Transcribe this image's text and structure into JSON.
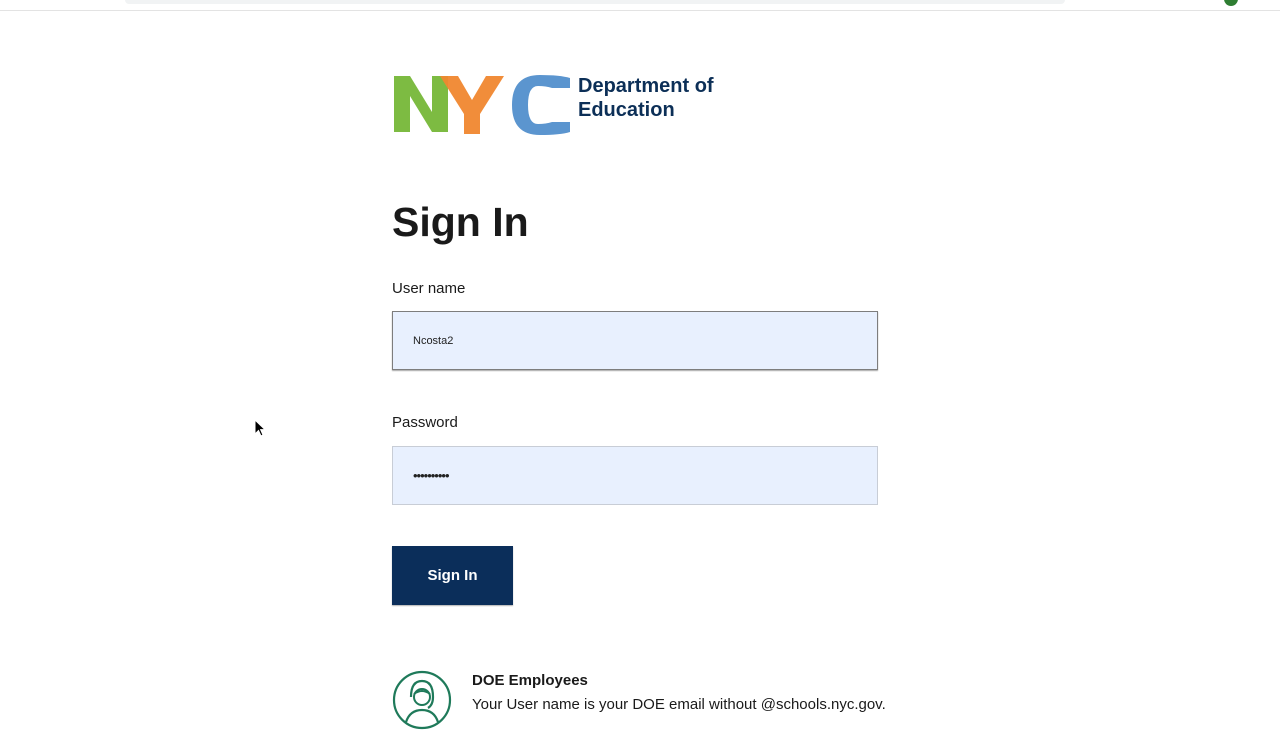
{
  "brand": {
    "logo_letters": "NYC",
    "department_line1": "Department of",
    "department_line2": "Education",
    "colors": {
      "n_green": "#7dbb42",
      "y_orange": "#f0872f",
      "c_blue": "#5b95cf",
      "navy_text": "#0c2f57"
    }
  },
  "form": {
    "title": "Sign In",
    "username_label": "User name",
    "username_value": "Ncosta2",
    "password_label": "Password",
    "password_value": "••••••••••",
    "submit_label": "Sign In",
    "button_color": "#0b2e5a",
    "field_fill": "#e8f0fe"
  },
  "employees": {
    "icon": "person-circle-icon",
    "heading": "DOE Employees",
    "text": "Your User name is your DOE email without @schools.nyc.gov."
  },
  "cursor": {
    "icon": "mouse-pointer-icon"
  }
}
